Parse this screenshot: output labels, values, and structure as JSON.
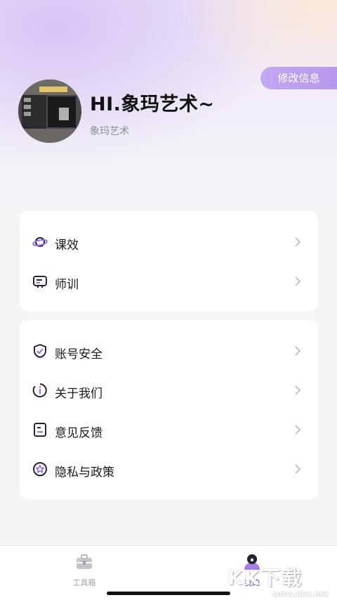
{
  "header": {
    "edit_label": "修改信息",
    "greeting": "HI.象玛艺术~",
    "username": "象玛艺术"
  },
  "menu_group_1": [
    {
      "label": "课效",
      "icon": "planet-icon"
    },
    {
      "label": "师训",
      "icon": "chat-robot-icon"
    }
  ],
  "menu_group_2": [
    {
      "label": "账号安全",
      "icon": "shield-icon"
    },
    {
      "label": "关于我们",
      "icon": "info-icon"
    },
    {
      "label": "意见反馈",
      "icon": "note-icon"
    },
    {
      "label": "隐私与政策",
      "icon": "star-badge-icon"
    }
  ],
  "tabbar": {
    "tools_label": "工具箱",
    "mine_label": "我的"
  },
  "watermark": {
    "text": "KK下载",
    "url": "www.kkx.net"
  },
  "colors": {
    "accent": "#b697ee",
    "active_tab": "#6b3fc4",
    "icon_stroke": "#2a2238"
  }
}
